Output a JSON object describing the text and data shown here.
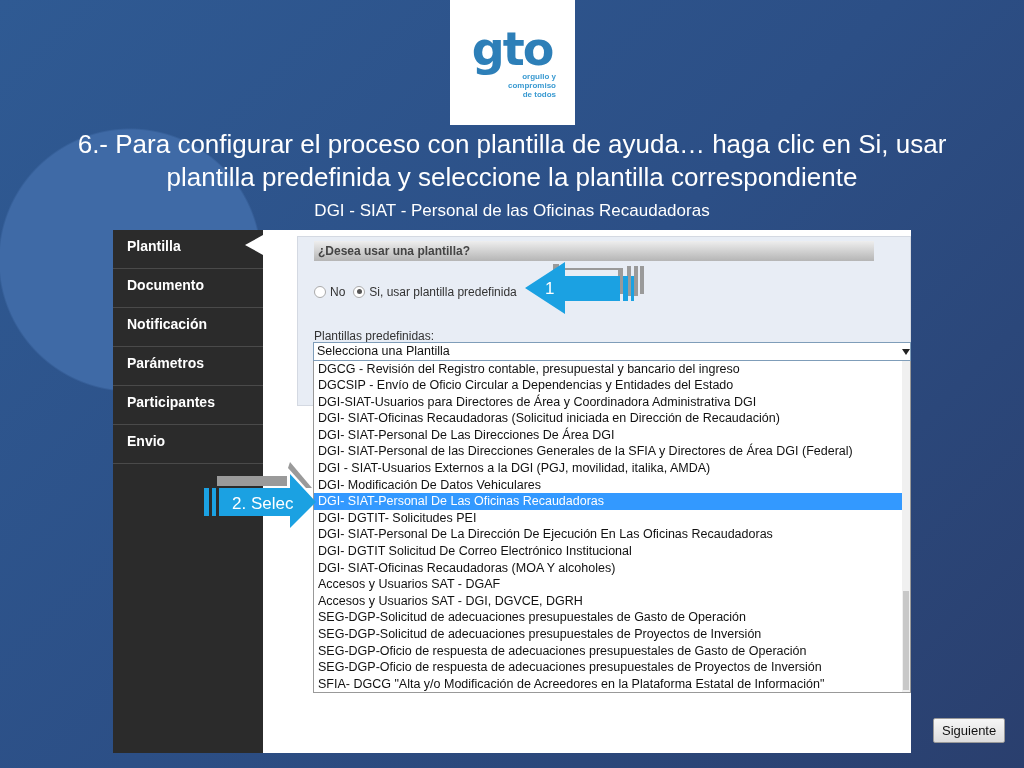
{
  "logo": {
    "wordmark": "gto",
    "tagline": [
      "orgullo y",
      "compromiso",
      "de todos"
    ]
  },
  "title": "6.- Para configurar el proceso con plantilla de ayuda… haga clic en Si, usar plantilla predefinida y seleccione la plantilla correspondiente",
  "subtitle": "DGI - SIAT - Personal de las Oficinas Recaudadoras",
  "sidebar": {
    "items": [
      {
        "label": "Plantilla",
        "selected": true
      },
      {
        "label": "Documento",
        "selected": false
      },
      {
        "label": "Notificación",
        "selected": false
      },
      {
        "label": "Parámetros",
        "selected": false
      },
      {
        "label": "Participantes",
        "selected": false
      },
      {
        "label": "Envio",
        "selected": false
      }
    ]
  },
  "panel": {
    "heading": "¿Desea usar una plantilla?",
    "radios": [
      {
        "label": "No",
        "selected": false
      },
      {
        "label": "Si, usar plantilla predefinida",
        "selected": true
      }
    ],
    "field_label": "Plantillas predefinidas:",
    "select": {
      "value": "Selecciona una Plantilla",
      "options": [
        {
          "label": "DGCG - Revisión del Registro contable, presupuestal y bancario del ingreso",
          "selected": false
        },
        {
          "label": "DGCSIP - Envío de Oficio Circular a Dependencias y Entidades del Estado",
          "selected": false
        },
        {
          "label": "DGI-SIAT-Usuarios para Directores de Área y Coordinadora Administrativa DGI",
          "selected": false
        },
        {
          "label": "DGI- SIAT-Oficinas Recaudadoras (Solicitud iniciada en Dirección de Recaudación)",
          "selected": false
        },
        {
          "label": "DGI- SIAT-Personal De Las Direcciones De Área DGI",
          "selected": false
        },
        {
          "label": "DGI- SIAT-Personal de las Direcciones Generales de la SFIA y Directores de Área DGI (Federal)",
          "selected": false
        },
        {
          "label": "DGI - SIAT-Usuarios Externos a la DGI (PGJ, movilidad, italika, AMDA)",
          "selected": false
        },
        {
          "label": "DGI- Modificación De Datos Vehiculares",
          "selected": false
        },
        {
          "label": "DGI- SIAT-Personal De Las Oficinas Recaudadoras",
          "selected": true
        },
        {
          "label": "DGI- DGTIT- Solicitudes PEI",
          "selected": false
        },
        {
          "label": "DGI- SIAT-Personal De La Dirección De Ejecución En Las Oficinas Recaudadoras",
          "selected": false
        },
        {
          "label": "DGI- DGTIT Solicitud De Correo Electrónico Institucional",
          "selected": false
        },
        {
          "label": "DGI- SIAT-Oficinas Recaudadoras (MOA Y alcoholes)",
          "selected": false
        },
        {
          "label": "Accesos y Usuarios SAT - DGAF",
          "selected": false
        },
        {
          "label": "Accesos y Usuarios SAT - DGI, DGVCE, DGRH",
          "selected": false
        },
        {
          "label": "SEG-DGP-Solicitud de adecuaciones presupuestales de Gasto de Operación",
          "selected": false
        },
        {
          "label": "SEG-DGP-Solicitud de adecuaciones presupuestales de Proyectos de Inversión",
          "selected": false
        },
        {
          "label": "SEG-DGP-Oficio de respuesta de adecuaciones presupuestales de Gasto de Operación",
          "selected": false
        },
        {
          "label": "SEG-DGP-Oficio de respuesta de adecuaciones presupuestales de Proyectos de Inversión",
          "selected": false
        },
        {
          "label": "SFIA- DGCG \"Alta y/o Modificación de Acreedores en la Plataforma Estatal de Información\"",
          "selected": false
        }
      ]
    }
  },
  "button": "Siguiente",
  "callouts": [
    {
      "label": "1",
      "kind": "left"
    },
    {
      "label": "2. Selec",
      "kind": "right"
    }
  ]
}
